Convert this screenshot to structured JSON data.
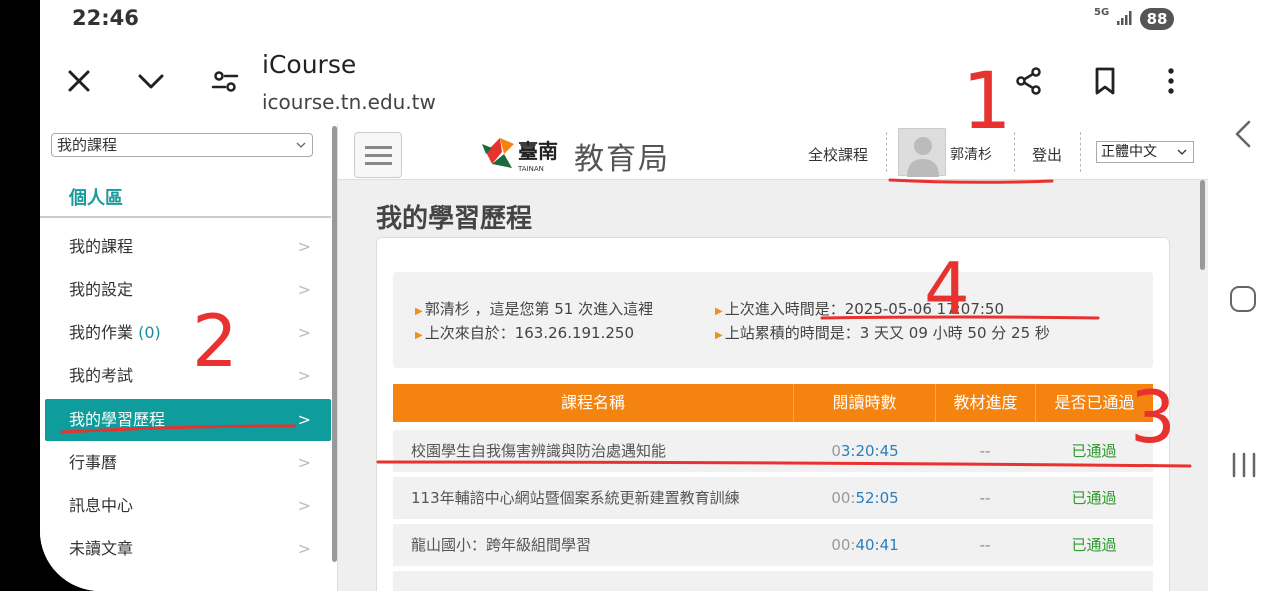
{
  "status": {
    "time": "22:46",
    "network": "5G",
    "battery": "88"
  },
  "browser": {
    "title": "iCourse",
    "url": "icourse.tn.edu.tw"
  },
  "sidebar": {
    "select_value": "我的課程",
    "section_title": "個人區",
    "items": [
      {
        "label": "我的課程"
      },
      {
        "label": "我的設定"
      },
      {
        "label": "我的作業",
        "badge": "(0)"
      },
      {
        "label": "我的考試"
      },
      {
        "label": "我的學習歷程"
      },
      {
        "label": "行事曆"
      },
      {
        "label": "訊息中心"
      },
      {
        "label": "未讀文章"
      }
    ]
  },
  "header": {
    "logo_caption": "TAINAN",
    "logo_text": "教育局",
    "all_courses": "全校課程",
    "user_name": "郭清杉",
    "logout": "登出",
    "language": "正體中文"
  },
  "main": {
    "title": "我的學習歷程",
    "info": {
      "welcome": "郭清杉 ，這是您第 51 次進入這裡",
      "last_login_time": "上次進入時間是：2025-05-06 17:07:50",
      "last_from": "上次來自於：163.26.191.250",
      "total_time": "上站累積的時間是：3 天又 09 小時 50 分 25 秒"
    },
    "table": {
      "headers": [
        "課程名稱",
        "閱讀時數",
        "教材進度",
        "是否已通過"
      ],
      "rows": [
        {
          "name": "校園學生自我傷害辨識與防治處遇知能",
          "time_pre": "0",
          "time_main": "3:20:45",
          "progress": "--",
          "passed": "已通過"
        },
        {
          "name": "113年輔諮中心網站暨個案系統更新建置教育訓練",
          "time_pre": "00:",
          "time_main": "52:05",
          "progress": "--",
          "passed": "已通過"
        },
        {
          "name": "龍山國小：跨年級組間學習",
          "time_pre": "00:",
          "time_main": "40:41",
          "progress": "--",
          "passed": "已通過"
        }
      ]
    }
  },
  "annotations": [
    "1",
    "2",
    "3",
    "4"
  ],
  "colors": {
    "teal": "#0f9c9c",
    "orange": "#f4840f",
    "annotation_red": "#e8322f",
    "pass_green": "#2e9a2e"
  }
}
